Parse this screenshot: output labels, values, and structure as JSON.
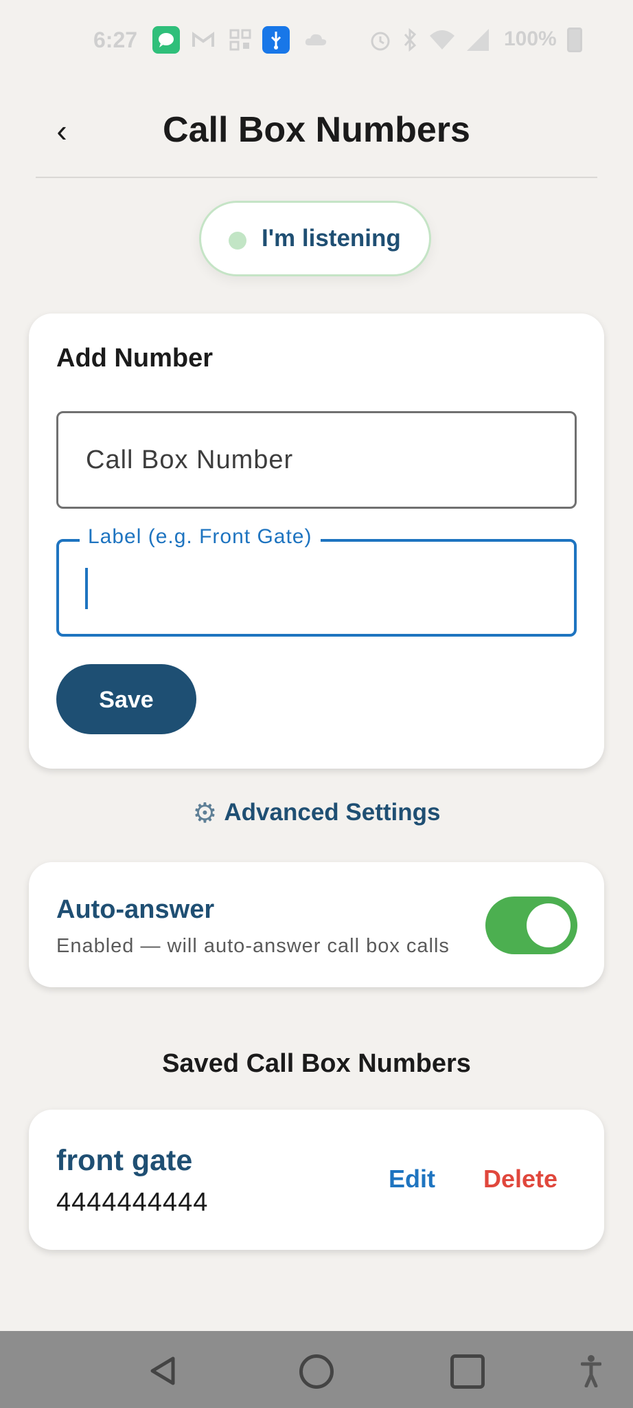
{
  "status_bar": {
    "time": "6:27",
    "battery": "100%",
    "icons": [
      "chat-icon",
      "gmail-icon",
      "qr-icon",
      "usb-icon",
      "cloud-icon",
      "alarm-icon",
      "bluetooth-icon",
      "wifi-icon",
      "signal-icon",
      "battery-icon"
    ]
  },
  "header": {
    "back_label": "‹",
    "title": "Call Box Numbers"
  },
  "listening": {
    "label": "I'm listening",
    "dot_color": "#c2e5c5"
  },
  "add_form": {
    "title": "Add Number",
    "number_placeholder": "Call Box Number",
    "number_value": "",
    "label_field_label": "Label (e.g. Front Gate)",
    "label_value": "",
    "save_label": "Save"
  },
  "advanced": {
    "icon": "gear-icon",
    "label": "Advanced Settings"
  },
  "auto_answer": {
    "title": "Auto-answer",
    "subtitle": "Enabled — will auto-answer call box calls",
    "enabled": true,
    "accent": "#4caf50"
  },
  "saved": {
    "heading": "Saved Call Box Numbers",
    "items": [
      {
        "label": "front gate",
        "number": "4444444444",
        "edit_label": "Edit",
        "delete_label": "Delete"
      }
    ]
  },
  "colors": {
    "brand": "#1e4f73",
    "focus": "#1e74c0",
    "danger": "#e0473c",
    "background": "#f3f1ee"
  }
}
